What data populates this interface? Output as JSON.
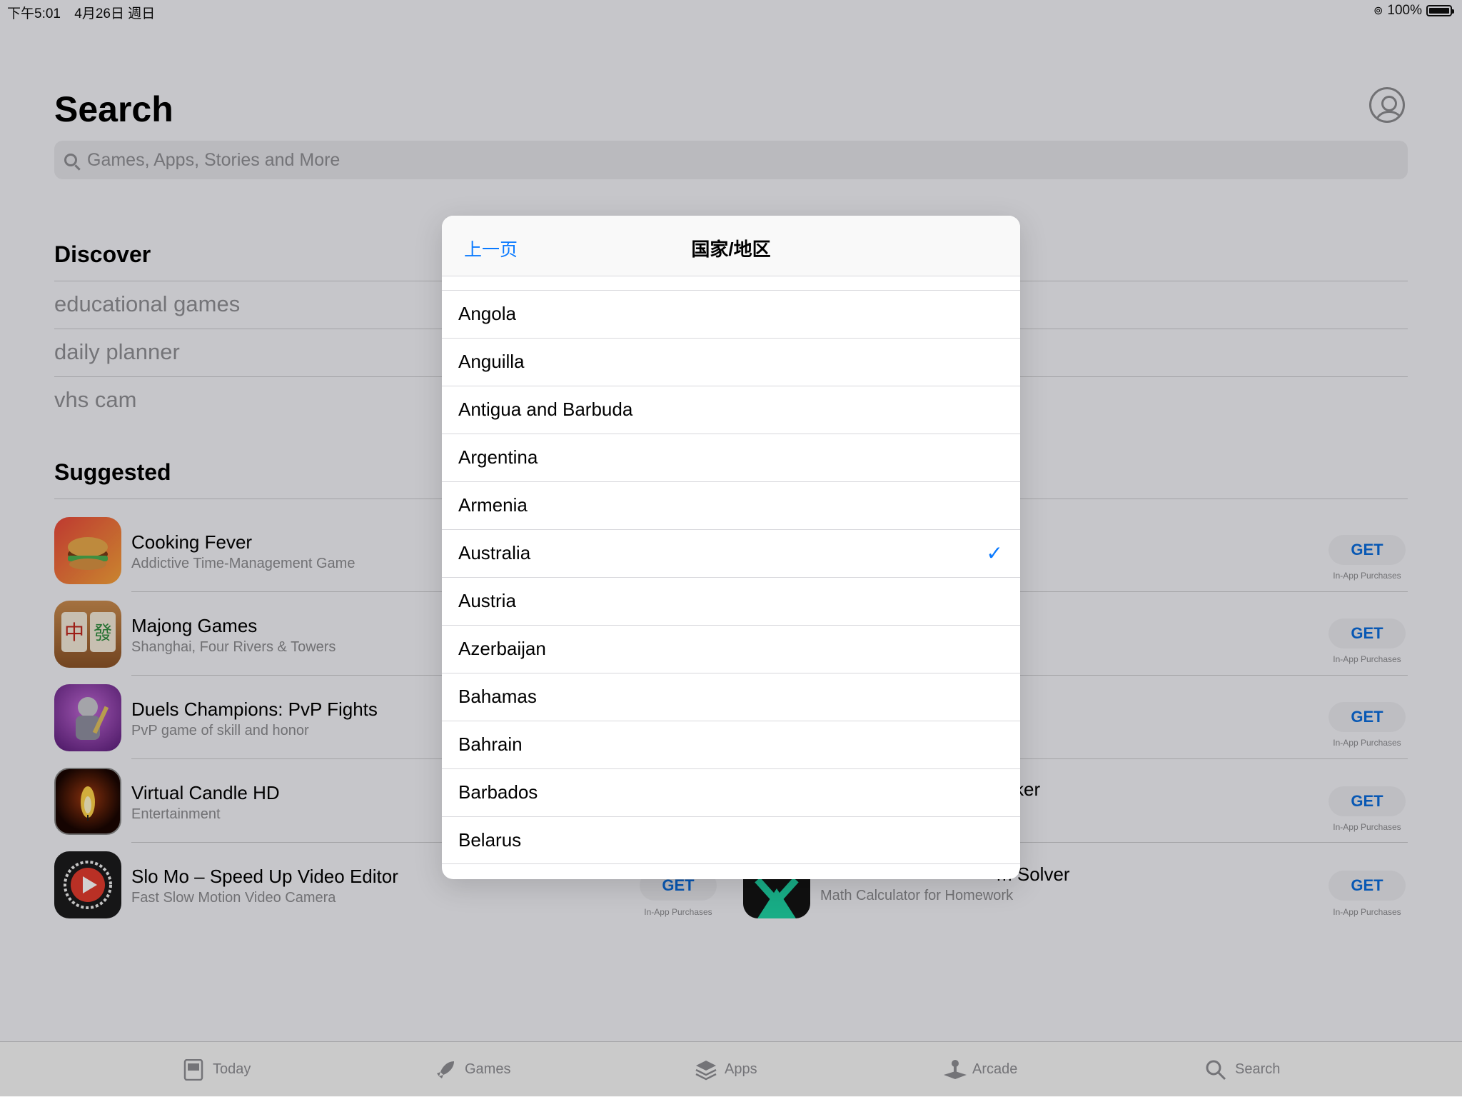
{
  "status_bar": {
    "time": "下午5:01",
    "date": "4月26日 週日",
    "battery": "100%"
  },
  "header": {
    "title": "Search"
  },
  "search": {
    "placeholder": "Games, Apps, Stories and More"
  },
  "discover": {
    "title": "Discover",
    "items": [
      "educational games",
      "daily planner",
      "vhs cam"
    ]
  },
  "suggested": {
    "title": "Suggested",
    "left": [
      {
        "name": "Cooking Fever",
        "subtitle": "Addictive Time-Management Game",
        "icon": "cooking-fever-icon"
      },
      {
        "name": "Majong Games",
        "subtitle": "Shanghai, Four Rivers & Towers",
        "icon": "majong-icon"
      },
      {
        "name": "Duels Champions: PvP Fights",
        "subtitle": "PvP game of skill and honor",
        "icon": "duels-champions-icon"
      },
      {
        "name": "Virtual Candle HD",
        "subtitle": "Entertainment",
        "icon": "candle-icon"
      },
      {
        "name": "Slo Mo – Speed Up Video Editor",
        "subtitle": "Fast Slow Motion Video Camera",
        "icon": "slo-mo-icon"
      }
    ],
    "right_partial": [
      {
        "text": "ker"
      },
      {
        "text": "m Solver",
        "subtitle": "Math Calculator for Homework"
      }
    ],
    "get_label": "GET",
    "iap_label": "In-App Purchases"
  },
  "modal": {
    "back_label": "上一页",
    "title": "国家/地区",
    "selected": "Australia",
    "countries": [
      "Angola",
      "Anguilla",
      "Antigua and Barbuda",
      "Argentina",
      "Armenia",
      "Australia",
      "Austria",
      "Azerbaijan",
      "Bahamas",
      "Bahrain",
      "Barbados",
      "Belarus"
    ]
  },
  "tab_bar": {
    "tabs": [
      {
        "label": "Today",
        "icon": "today-icon"
      },
      {
        "label": "Games",
        "icon": "rocket-icon"
      },
      {
        "label": "Apps",
        "icon": "layers-icon"
      },
      {
        "label": "Arcade",
        "icon": "joystick-icon"
      },
      {
        "label": "Search",
        "icon": "search-icon"
      }
    ]
  },
  "colors": {
    "accent": "#0a7aff",
    "get_button_text": "#0a6cdc",
    "overlay": "rgba(0,0,0,0.18)"
  }
}
